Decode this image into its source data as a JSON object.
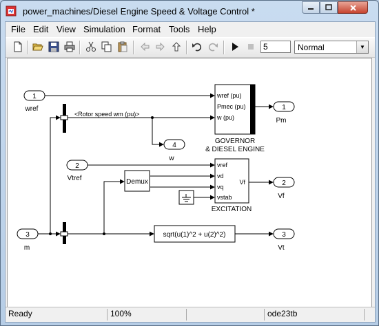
{
  "window": {
    "title": "power_machines/Diesel Engine Speed & Voltage Control *",
    "controls": [
      "minimize-icon",
      "maximize-icon",
      "close-icon"
    ]
  },
  "menu": [
    "File",
    "Edit",
    "View",
    "Simulation",
    "Format",
    "Tools",
    "Help"
  ],
  "toolbar": {
    "buttons": [
      "new-icon",
      "open-icon",
      "save-icon",
      "print-icon",
      "cut-icon",
      "copy-icon",
      "paste-icon",
      "back-icon",
      "forward-icon",
      "up-icon",
      "undo-icon",
      "redo-icon",
      "start-icon",
      "stop-icon"
    ],
    "stop_time": "5",
    "sim_mode": "Normal"
  },
  "diagram": {
    "inports": [
      {
        "num": "1",
        "label": "wref"
      },
      {
        "num": "2",
        "label": "Vtref"
      },
      {
        "num": "3",
        "label": "m"
      }
    ],
    "outports": [
      {
        "num": "1",
        "label": "Pm"
      },
      {
        "num": "4",
        "label": "w"
      },
      {
        "num": "2",
        "label": "Vf"
      },
      {
        "num": "3",
        "label": "Vt"
      }
    ],
    "bus_label": "<Rotor speed  wm  (pu)>",
    "governor": {
      "ports": [
        "wref (pu)",
        "Pmec (pu)",
        "w (pu)"
      ],
      "name_line1": "GOVERNOR",
      "name_line2": "& DIESEL ENGINE"
    },
    "excitation": {
      "inputs": [
        "vref",
        "vd",
        "vq",
        "vstab"
      ],
      "output": "Vf",
      "name": "EXCITATION"
    },
    "demux_label": "Demux",
    "fcn_expr": "sqrt(u(1)^2 + u(2)^2)"
  },
  "status": {
    "state": "Ready",
    "zoom": "100%",
    "solver": "ode23tb"
  }
}
